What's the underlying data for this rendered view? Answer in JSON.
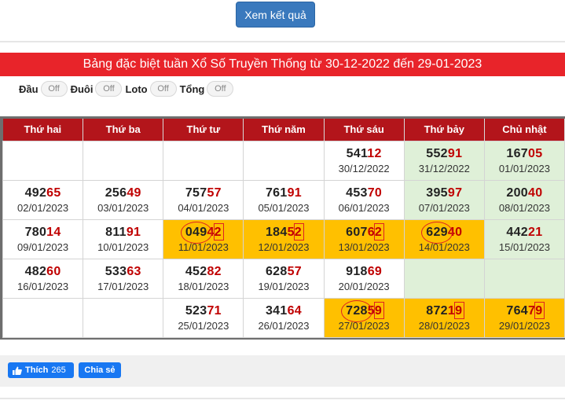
{
  "header": {
    "result_button": "Xem kết quả"
  },
  "banner": {
    "title": "Bảng đặc biệt tuần Xổ Số Truyền Thống từ 30-12-2022 đến 29-01-2023"
  },
  "toggles": [
    {
      "label": "Đầu",
      "state": "Off"
    },
    {
      "label": "Đuôi",
      "state": "Off"
    },
    {
      "label": "Loto",
      "state": "Off"
    },
    {
      "label": "Tổng",
      "state": "Off"
    }
  ],
  "table": {
    "headers": [
      "Thứ hai",
      "Thứ ba",
      "Thứ tư",
      "Thứ năm",
      "Thứ sáu",
      "Thứ bảy",
      "Chủ nhật"
    ],
    "rows": [
      [
        {
          "head": "",
          "tail": "",
          "date": "",
          "bg": "white"
        },
        {
          "head": "",
          "tail": "",
          "date": "",
          "bg": "white"
        },
        {
          "head": "",
          "tail": "",
          "date": "",
          "bg": "white"
        },
        {
          "head": "",
          "tail": "",
          "date": "",
          "bg": "white"
        },
        {
          "head": "541",
          "tail": "12",
          "date": "30/12/2022",
          "bg": "white"
        },
        {
          "head": "552",
          "tail": "91",
          "date": "31/12/2022",
          "bg": "green"
        },
        {
          "head": "167",
          "tail": "05",
          "date": "01/01/2023",
          "bg": "green"
        }
      ],
      [
        {
          "head": "492",
          "tail": "65",
          "date": "02/01/2023",
          "bg": "white"
        },
        {
          "head": "256",
          "tail": "49",
          "date": "03/01/2023",
          "bg": "white"
        },
        {
          "head": "757",
          "tail": "57",
          "date": "04/01/2023",
          "bg": "white"
        },
        {
          "head": "761",
          "tail": "91",
          "date": "05/01/2023",
          "bg": "white"
        },
        {
          "head": "453",
          "tail": "70",
          "date": "06/01/2023",
          "bg": "white"
        },
        {
          "head": "395",
          "tail": "97",
          "date": "07/01/2023",
          "bg": "green"
        },
        {
          "head": "200",
          "tail": "40",
          "date": "08/01/2023",
          "bg": "green"
        }
      ],
      [
        {
          "head": "780",
          "tail": "14",
          "date": "09/01/2023",
          "bg": "white"
        },
        {
          "head": "811",
          "tail": "91",
          "date": "10/01/2023",
          "bg": "white"
        },
        {
          "head": "049",
          "tail": "42",
          "date": "11/01/2023",
          "bg": "gold",
          "mark": "circle-box"
        },
        {
          "head": "184",
          "tail": "52",
          "date": "12/01/2023",
          "bg": "gold",
          "mark": "box"
        },
        {
          "head": "607",
          "tail": "62",
          "date": "13/01/2023",
          "bg": "gold",
          "mark": "box"
        },
        {
          "head": "629",
          "tail": "40",
          "date": "14/01/2023",
          "bg": "gold",
          "mark": "circle"
        },
        {
          "head": "442",
          "tail": "21",
          "date": "15/01/2023",
          "bg": "green"
        }
      ],
      [
        {
          "head": "482",
          "tail": "60",
          "date": "16/01/2023",
          "bg": "white"
        },
        {
          "head": "533",
          "tail": "63",
          "date": "17/01/2023",
          "bg": "white"
        },
        {
          "head": "452",
          "tail": "82",
          "date": "18/01/2023",
          "bg": "white"
        },
        {
          "head": "628",
          "tail": "57",
          "date": "19/01/2023",
          "bg": "white"
        },
        {
          "head": "918",
          "tail": "69",
          "date": "20/01/2023",
          "bg": "white"
        },
        {
          "head": "",
          "tail": "",
          "date": "",
          "bg": "green"
        },
        {
          "head": "",
          "tail": "",
          "date": "",
          "bg": "green"
        }
      ],
      [
        {
          "head": "",
          "tail": "",
          "date": "",
          "bg": "white"
        },
        {
          "head": "",
          "tail": "",
          "date": "",
          "bg": "white"
        },
        {
          "head": "523",
          "tail": "71",
          "date": "25/01/2023",
          "bg": "white"
        },
        {
          "head": "341",
          "tail": "64",
          "date": "26/01/2023",
          "bg": "white"
        },
        {
          "head": "728",
          "tail": "59",
          "date": "27/01/2023",
          "bg": "gold",
          "mark": "circle-box"
        },
        {
          "head": "872",
          "tail": "19",
          "date": "28/01/2023",
          "bg": "gold",
          "mark": "box"
        },
        {
          "head": "764",
          "tail": "79",
          "date": "29/01/2023",
          "bg": "gold",
          "mark": "box"
        }
      ]
    ]
  },
  "social": {
    "like_label": "Thích",
    "like_count": "265",
    "share_label": "Chia sẻ"
  },
  "colors": {
    "banner": "#e8242a",
    "header_row": "#b3151b",
    "highlight": "#ffc000",
    "weekend": "#dff0d8",
    "button": "#3a79bd"
  }
}
